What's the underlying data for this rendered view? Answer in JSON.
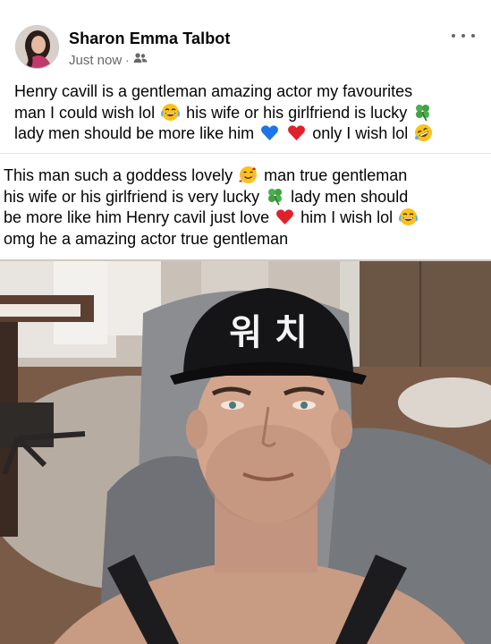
{
  "post": {
    "author": "Sharon Emma Talbot",
    "timestamp": "Just now",
    "separator": "·",
    "audience_icon": "friends-icon",
    "caption": {
      "line1": "Henry cavill is  a gentleman amazing actor my favourites",
      "line2a": "man I could wish lol",
      "line2b": "his wife or his girlfriend is lucky",
      "line3a": "lady men should be more like him",
      "line3b": "only I wish lol"
    },
    "image_text": {
      "line1a": "This man such a goddess lovely",
      "line1b": "man true gentleman",
      "line2a": "his wife or his girlfriend is very lucky",
      "line2b": "lady men should",
      "line3a": "be more like him Henry cavil just love",
      "line3b": "him I wish lol",
      "line4": "omg he a amazing actor true gentleman"
    },
    "cap_text": "워 치",
    "emojis": [
      "laughing-tears-icon",
      "four-leaf-clover-icon",
      "blue-heart-icon",
      "red-heart-icon",
      "rolling-laughing-icon",
      "smiling-hearts-icon",
      "four-leaf-clover-icon",
      "red-heart-icon",
      "laughing-tears-icon"
    ]
  }
}
